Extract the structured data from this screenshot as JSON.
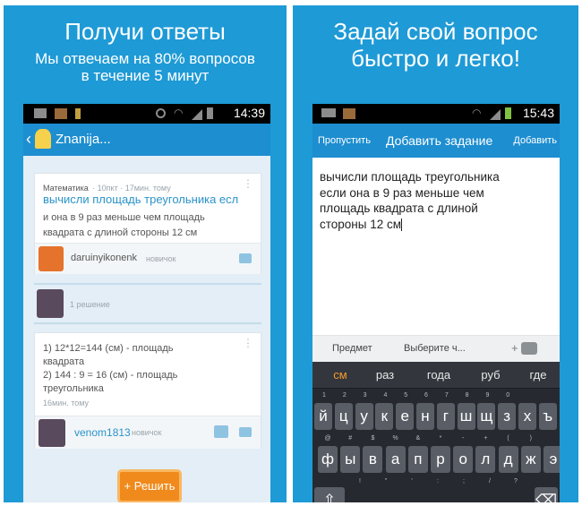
{
  "left": {
    "headline": "Получи ответы",
    "sub1": "Мы отвечаем на 80% вопросов",
    "sub2": "в течение 5 минут",
    "time": "14:39",
    "app_title": "Znanija...",
    "question": {
      "subject": "Математика",
      "meta": "· 10пкт · 17мин. тому",
      "title": "вычисли площадь треугольника есл",
      "body1": "и она в 9 раз меньше чем площадь",
      "body2": "квадрата с длиной стороны 12 см",
      "user": "daruinyikonenk",
      "rank": "новичок"
    },
    "solutions_count": "1 решение",
    "answer": {
      "line1": "1) 12*12=144 (см) - площадь",
      "line2": "квадрата",
      "line3": "2) 144 : 9 = 16 (см) - площадь",
      "line4": "треугольника",
      "time": "16мин. тому",
      "user": "venom1813",
      "rank": "новичок"
    },
    "solve_button": "+ Решить"
  },
  "right": {
    "headline1": "Задай свой вопрос",
    "headline2": "быстро и легко!",
    "time": "15:43",
    "skip": "Пропустить",
    "title": "Добавить задание",
    "add": "Добавить",
    "text1": "вычисли площадь треугольника",
    "text2": "если она в 9 раз меньше чем",
    "text3": "площадь квадрата с длиной",
    "text4": "стороны 12 см",
    "subject_label": "Предмет",
    "choose": "Выберите ч...",
    "camera": "+",
    "suggestions": [
      "см",
      "раз",
      "года",
      "руб",
      "где"
    ],
    "row_nums": [
      "1",
      "2",
      "3",
      "4",
      "5",
      "6",
      "7",
      "8",
      "9",
      "0"
    ],
    "row1": [
      "й",
      "ц",
      "у",
      "к",
      "е",
      "н",
      "г",
      "ш",
      "щ",
      "з",
      "х",
      "ъ"
    ],
    "row2": [
      "ф",
      "ы",
      "в",
      "а",
      "п",
      "р",
      "о",
      "л",
      "д",
      "ж",
      "э"
    ],
    "row2_top": [
      "@",
      "#",
      "$",
      "%",
      "&",
      "*",
      "-",
      "+",
      "(",
      ")",
      ""
    ],
    "row3_top": [
      "!",
      "\"",
      "'",
      ":",
      ";",
      "/",
      "?"
    ]
  },
  "colors": {
    "accent": "#1e9ad6",
    "orange": "#f08a1c",
    "link": "#2b93c9"
  }
}
